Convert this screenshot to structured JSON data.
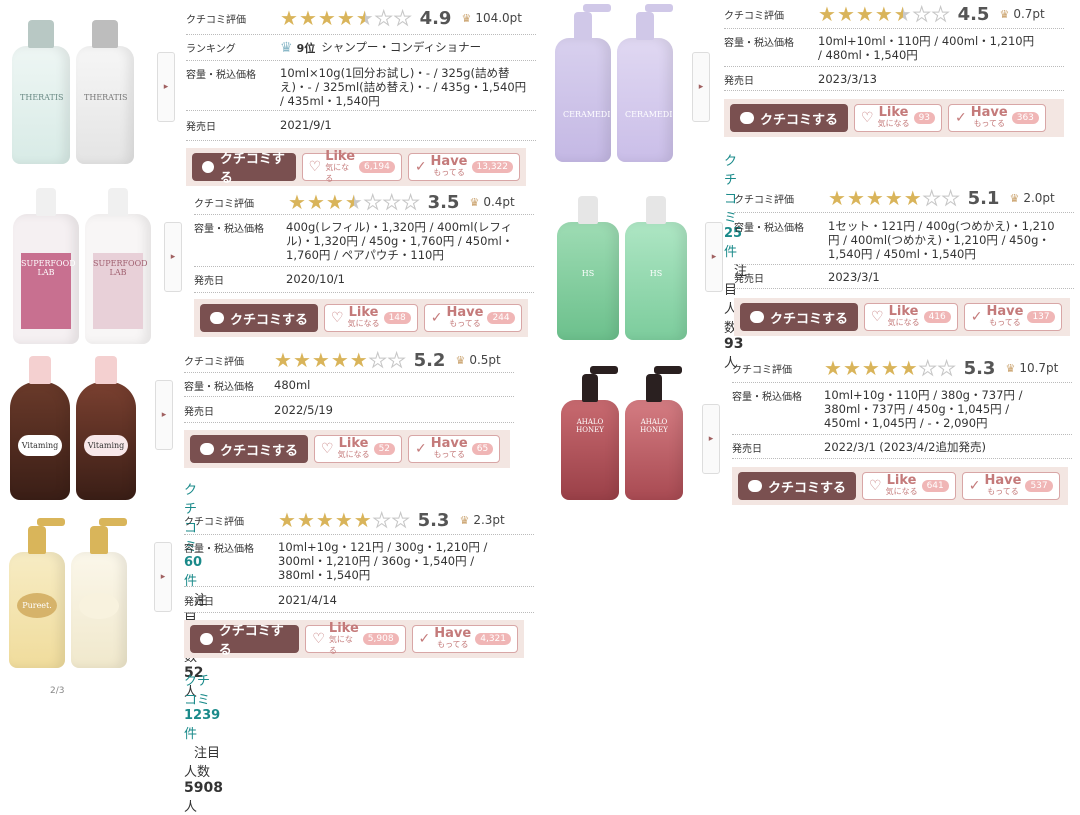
{
  "labels": {
    "rating": "クチコミ評価",
    "ranking": "ランキング",
    "volume_price": "容量・税込価格",
    "release": "発売日",
    "review_btn": "クチコミする",
    "like": "Like",
    "like_sub": "気になる",
    "have": "Have",
    "have_sub": "もってる",
    "kuchikomi": "クチコミ",
    "ken": "件",
    "attention": "注目人数",
    "nin": "人"
  },
  "products": [
    {
      "score": "4.9",
      "pt": "104.0pt",
      "stars": [
        1,
        1,
        1,
        1,
        0.5,
        0,
        0
      ],
      "rank_num": "9位",
      "rank_cat": "シャンプー・コンディショナー",
      "volume": "10ml×10g(1回分お試し)・- / 325g(詰め替え)・- / 325ml(詰め替え)・- / 435g・1,540円 / 435ml・1,540円",
      "release": "2021/9/1",
      "like": "6,194",
      "have": "13,322"
    },
    {
      "score": "4.5",
      "pt": "0.7pt",
      "stars": [
        1,
        1,
        1,
        1,
        0.5,
        0,
        0
      ],
      "volume": "10ml+10ml・110円 / 400ml・1,210円 / 480ml・1,540円",
      "release": "2023/3/13",
      "like": "93",
      "have": "363",
      "reviews": "25",
      "attention": "93"
    },
    {
      "score": "3.5",
      "pt": "0.4pt",
      "stars": [
        1,
        1,
        1,
        0.5,
        0,
        0,
        0
      ],
      "volume": "400g(レフィル)・1,320円 / 400ml(レフィル)・1,320円 / 450g・1,760円 / 450ml・1,760円 / ペアパウチ・110円",
      "release": "2020/10/1",
      "like": "148",
      "have": "244"
    },
    {
      "score": "5.1",
      "pt": "2.0pt",
      "stars": [
        1,
        1,
        1,
        1,
        1,
        0,
        0
      ],
      "volume": "1セット・121円 / 400g(つめかえ)・1,210円 / 400ml(つめかえ)・1,210円 / 450g・1,540円 / 450ml・1,540円",
      "release": "2023/3/1",
      "like": "416",
      "have": "137"
    },
    {
      "score": "5.2",
      "pt": "0.5pt",
      "stars": [
        1,
        1,
        1,
        1,
        1,
        0,
        0
      ],
      "volume": "480ml",
      "release": "2022/5/19",
      "like": "52",
      "have": "65",
      "reviews": "60",
      "attention": "52"
    },
    {
      "score": "5.3",
      "pt": "10.7pt",
      "stars": [
        1,
        1,
        1,
        1,
        1,
        0,
        0
      ],
      "volume": "10ml+10g・110円 / 380g・737円 / 380ml・737円 / 450g・1,045円 / 450ml・1,045円 / -・2,090円",
      "release": "2022/3/1 (2023/4/2追加発売)",
      "like": "641",
      "have": "537"
    },
    {
      "score": "5.3",
      "pt": "2.3pt",
      "stars": [
        1,
        1,
        1,
        1,
        1,
        0,
        0
      ],
      "volume": "10ml+10g・121円 / 300g・1,210円 / 300ml・1,210円 / 360g・1,540円 / 380ml・1,540円",
      "release": "2021/4/14",
      "like": "5,908",
      "have": "4,321",
      "reviews": "1239",
      "attention": "5908"
    }
  ],
  "bottle_labels": [
    "THERATIS",
    "THERATIS",
    "SUPERFOOD LAB",
    "SUPERFOOD LAB",
    "Vitaming",
    "Vitaming",
    "Pureet.",
    "",
    "CERAMEDI",
    "CERAMEDI",
    "HS",
    "HS",
    "AHALO HONEY",
    "AHALO HONEY"
  ],
  "page_indicator": "2/3",
  "colors": {
    "accent": "#7a5050",
    "star": "#d9b45a",
    "link": "#1a8a8a",
    "like": "#c47a7a"
  }
}
